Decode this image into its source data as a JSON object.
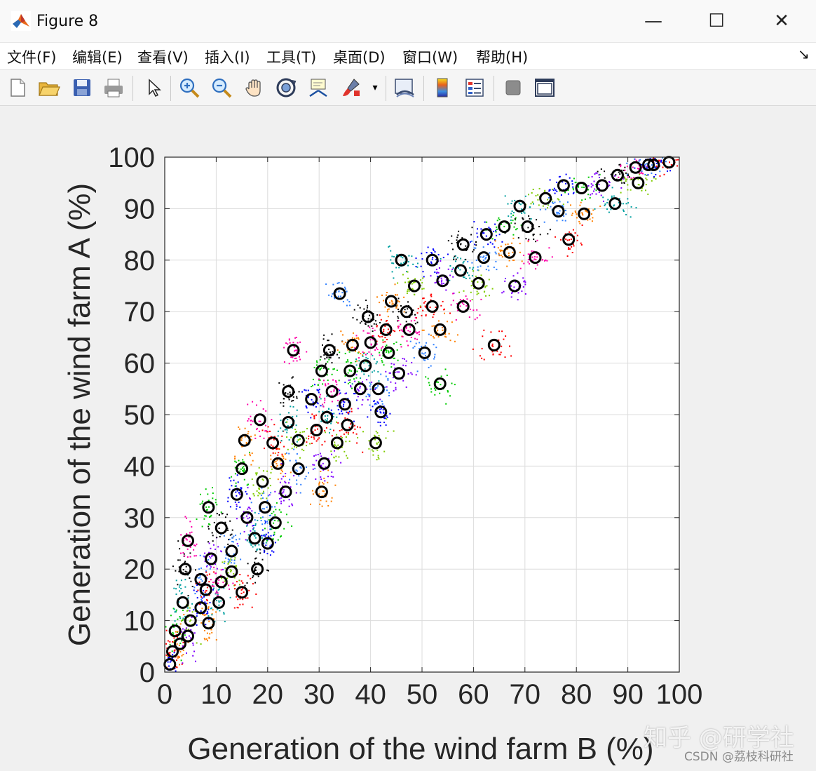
{
  "window": {
    "title": "Figure 8",
    "minimize_glyph": "—",
    "maximize_glyph": "☐",
    "close_glyph": "✕"
  },
  "menubar": {
    "items": [
      "文件(F)",
      "编辑(E)",
      "查看(V)",
      "插入(I)",
      "工具(T)",
      "桌面(D)",
      "窗口(W)",
      "帮助(H)"
    ],
    "dock_glyph": "↘"
  },
  "toolbar": {
    "icons": [
      "new-figure-icon",
      "open-icon",
      "save-icon",
      "print-icon",
      "pointer-icon",
      "zoom-in-icon",
      "zoom-out-icon",
      "pan-icon",
      "rotate-3d-icon",
      "data-cursor-icon",
      "brush-icon",
      "link-plot-icon",
      "colorbar-icon",
      "legend-icon",
      "hide-plot-tools-icon",
      "show-plot-tools-icon"
    ]
  },
  "watermark": {
    "main": "知乎 @研学社",
    "sub": "CSDN @荔枝科研社"
  },
  "chart_data": {
    "type": "scatter",
    "xlabel": "Generation of the wind farm B (%)",
    "ylabel": "Generation of the wind farm A (%)",
    "xlim": [
      0,
      100
    ],
    "ylim": [
      0,
      100
    ],
    "xticks": [
      "0",
      "10",
      "20",
      "30",
      "40",
      "50",
      "60",
      "70",
      "80",
      "90",
      "100"
    ],
    "yticks": [
      "0",
      "10",
      "20",
      "30",
      "40",
      "50",
      "60",
      "70",
      "80",
      "90",
      "100"
    ],
    "grid": true,
    "background_points": "dense colored dot clouds around each circle marker",
    "marker_style": "black open circles",
    "cluster_colors": [
      "#0000ff",
      "#ff0000",
      "#00cc00",
      "#ff8000",
      "#8000ff",
      "#00a0a0",
      "#000000",
      "#ff00aa",
      "#80cc00",
      "#3080ff"
    ],
    "points": [
      [
        1,
        1.5
      ],
      [
        1.5,
        4
      ],
      [
        2,
        8
      ],
      [
        3,
        5.5
      ],
      [
        4.5,
        7
      ],
      [
        3.5,
        13.5
      ],
      [
        4,
        20
      ],
      [
        4.5,
        25.5
      ],
      [
        5,
        10
      ],
      [
        7,
        18
      ],
      [
        7,
        12.5
      ],
      [
        8,
        16
      ],
      [
        8.5,
        32
      ],
      [
        8.5,
        9.5
      ],
      [
        9,
        22
      ],
      [
        10.5,
        13.5
      ],
      [
        11,
        28
      ],
      [
        11,
        17.5
      ],
      [
        13,
        19.5
      ],
      [
        13,
        23.5
      ],
      [
        14,
        34.5
      ],
      [
        15,
        15.5
      ],
      [
        15,
        39.5
      ],
      [
        15.5,
        45
      ],
      [
        16,
        30
      ],
      [
        17.5,
        26
      ],
      [
        18,
        20
      ],
      [
        18.5,
        49
      ],
      [
        19,
        37
      ],
      [
        19.5,
        32
      ],
      [
        20,
        25
      ],
      [
        21,
        44.5
      ],
      [
        21.5,
        29
      ],
      [
        22,
        40.5
      ],
      [
        23.5,
        35
      ],
      [
        24,
        48.5
      ],
      [
        24,
        54.5
      ],
      [
        25,
        62.5
      ],
      [
        26,
        45
      ],
      [
        26,
        39.5
      ],
      [
        28.5,
        53
      ],
      [
        29.5,
        47
      ],
      [
        30.5,
        58.5
      ],
      [
        30.5,
        35
      ],
      [
        31,
        40.5
      ],
      [
        31.5,
        49.5
      ],
      [
        32,
        62.5
      ],
      [
        32.5,
        54.5
      ],
      [
        33.5,
        44.5
      ],
      [
        34,
        73.5
      ],
      [
        35,
        52
      ],
      [
        35.5,
        48
      ],
      [
        36,
        58.5
      ],
      [
        36.5,
        63.5
      ],
      [
        38,
        55
      ],
      [
        39,
        59.5
      ],
      [
        39.5,
        69
      ],
      [
        40,
        64
      ],
      [
        41,
        44.5
      ],
      [
        41.5,
        55
      ],
      [
        42,
        50.5
      ],
      [
        43,
        66.5
      ],
      [
        43.5,
        62
      ],
      [
        44,
        72
      ],
      [
        45.5,
        58
      ],
      [
        46,
        80
      ],
      [
        47,
        70
      ],
      [
        47.5,
        66.5
      ],
      [
        48.5,
        75
      ],
      [
        50.5,
        62
      ],
      [
        52,
        80
      ],
      [
        52,
        71
      ],
      [
        53.5,
        56
      ],
      [
        53.5,
        66.5
      ],
      [
        54,
        76
      ],
      [
        57.5,
        78
      ],
      [
        58,
        83
      ],
      [
        58,
        71
      ],
      [
        61,
        75.5
      ],
      [
        62,
        80.5
      ],
      [
        62.5,
        85
      ],
      [
        64,
        63.5
      ],
      [
        66,
        86.5
      ],
      [
        67,
        81.5
      ],
      [
        68,
        75
      ],
      [
        69,
        90.5
      ],
      [
        70.5,
        86.5
      ],
      [
        72,
        80.5
      ],
      [
        74,
        92
      ],
      [
        76.5,
        89.5
      ],
      [
        77.5,
        94.5
      ],
      [
        78.5,
        84
      ],
      [
        81,
        94
      ],
      [
        81.5,
        89
      ],
      [
        85,
        94.5
      ],
      [
        87.5,
        91
      ],
      [
        88,
        96.5
      ],
      [
        91.5,
        98
      ],
      [
        92,
        95
      ],
      [
        94,
        98.5
      ],
      [
        95,
        98.5
      ],
      [
        98,
        99
      ]
    ]
  }
}
